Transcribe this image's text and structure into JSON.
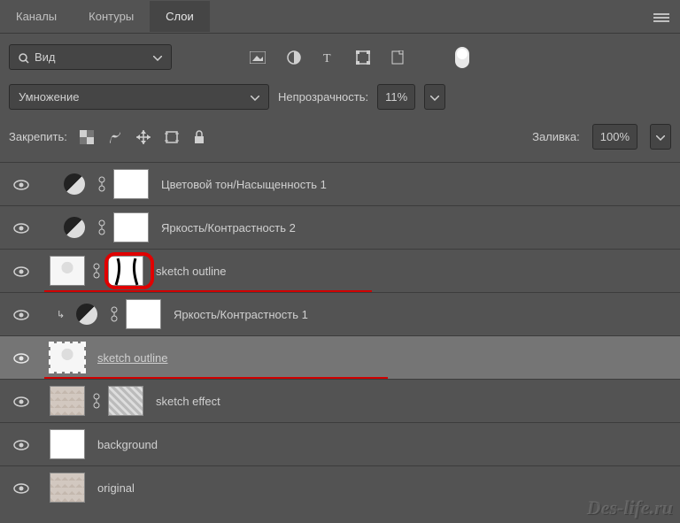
{
  "tabs": {
    "channels": "Каналы",
    "paths": "Контуры",
    "layers": "Слои"
  },
  "view": {
    "label": "Вид"
  },
  "blend": {
    "mode": "Умножение",
    "opacity_label": "Непрозрачность:",
    "opacity_value": "11%"
  },
  "lock": {
    "label": "Закрепить:",
    "fill_label": "Заливка:",
    "fill_value": "100%"
  },
  "layers_list": [
    {
      "name": "Цветовой тон/Насыщенность 1"
    },
    {
      "name": "Яркость/Контрастность 2"
    },
    {
      "name": "sketch outline"
    },
    {
      "name": "Яркость/Контрастность 1"
    },
    {
      "name": "sketch outline"
    },
    {
      "name": "sketch effect"
    },
    {
      "name": "background"
    },
    {
      "name": "original"
    }
  ],
  "watermark": "Des-life.ru"
}
